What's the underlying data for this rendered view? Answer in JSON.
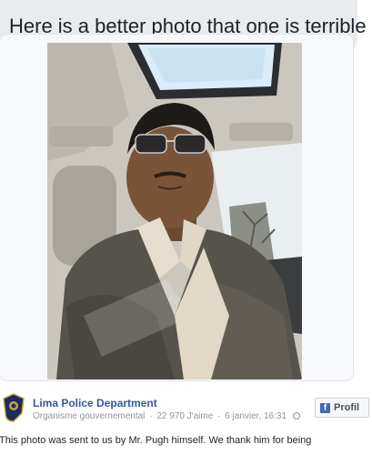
{
  "comment": {
    "text": "Here is a better photo that one is terrible"
  },
  "post": {
    "page_name": "Lima Police Department",
    "meta": {
      "category": "Organisme gouvernemental",
      "likes": "22 970 J'aime",
      "date": "6 janvier, 16:31"
    },
    "profile_button_label": "Profil",
    "body_line_1": "This photo was sent to us by Mr. Pugh himself. We thank him for being",
    "body_line_2": ""
  },
  "colors": {
    "link": "#365899",
    "meta": "#90949c",
    "bubble": "#e9ebee",
    "facebook_blue": "#4267b2"
  },
  "icons": {
    "avatar": "police-badge-icon",
    "privacy": "globe-icon",
    "profile": "facebook-icon"
  }
}
